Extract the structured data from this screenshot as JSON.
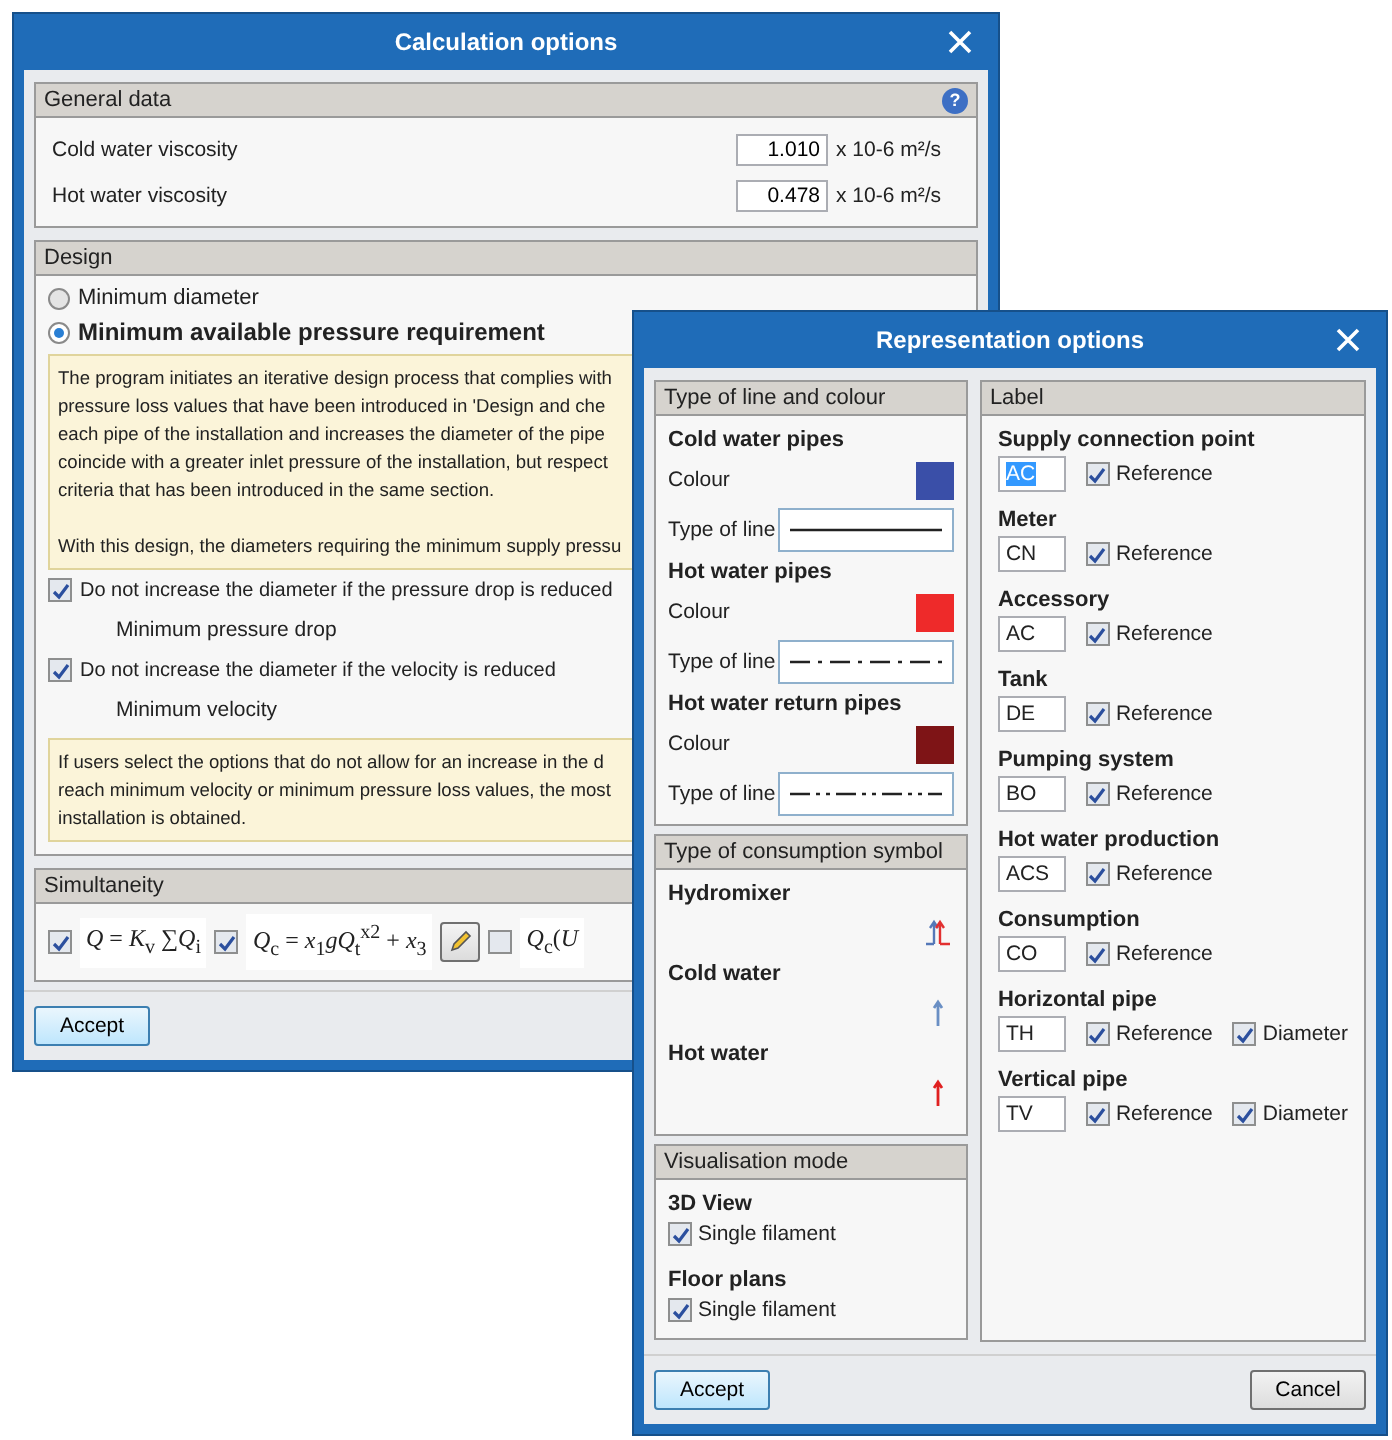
{
  "calculation_window": {
    "title": "Calculation options",
    "general_data": {
      "title": "General data",
      "help": "?",
      "rows": [
        {
          "label": "Cold water viscosity",
          "value": "1.010",
          "unit": "x 10-6 m²/s"
        },
        {
          "label": "Hot water viscosity",
          "value": "0.478",
          "unit": "x 10-6 m²/s"
        }
      ]
    },
    "design": {
      "title": "Design",
      "options": [
        {
          "label": "Minimum diameter",
          "selected": false
        },
        {
          "label": "Minimum available pressure requirement",
          "selected": true
        }
      ],
      "info": "The program initiates an iterative design process that complies with\npressure loss values that have been introduced in 'Design and che\neach pipe of the installation and increases the diameter of the pipe\ncoincide with a greater inlet pressure of the installation, but respect\ncriteria that has been introduced in the same section.\n\nWith this design, the diameters requiring the minimum supply pressu",
      "checks": [
        {
          "label": "Do not increase the diameter if the pressure drop is reduced",
          "checked": true,
          "sublabel": "Minimum pressure drop"
        },
        {
          "label": "Do not increase the diameter if the velocity is reduced",
          "checked": true,
          "sublabel": "Minimum velocity"
        }
      ],
      "note": "If users select the options that do not allow for an increase in the d\nreach minimum velocity or minimum pressure loss values, the most\ninstallation is obtained."
    },
    "simultaneity": {
      "title": "Simultaneity",
      "formulas": [
        {
          "formula": "*Q* = *K*$_{v}$ ∑*Q*$_{i}$",
          "checked": true,
          "editable": false
        },
        {
          "formula": "*Q*$_{c}$ = *x*$_{1}$*gQ*$_{t}$$^{x2}$ + *x*$_{3}$",
          "checked": true,
          "editable": true
        },
        {
          "formula": "*Q*$_{c}$(*U*",
          "checked": false,
          "editable": false
        }
      ]
    },
    "accept": "Accept"
  },
  "representation_window": {
    "title": "Representation options",
    "line_group": {
      "title": "Type of line and colour",
      "pipes": [
        {
          "name": "Cold water pipes",
          "colour_label": "Colour",
          "color": "#3a4fa8",
          "line_label": "Type of line",
          "kind": "solid"
        },
        {
          "name": "Hot water pipes",
          "colour_label": "Colour",
          "color": "#ee2a2a",
          "line_label": "Type of line",
          "kind": "dash-dot"
        },
        {
          "name": "Hot water return pipes",
          "colour_label": "Colour",
          "color": "#7e1416",
          "line_label": "Type of line",
          "kind": "dash-dot-dot"
        }
      ]
    },
    "symbol_group": {
      "title": "Type of consumption symbol",
      "symbols": [
        {
          "name": "Hydromixer",
          "kind": "mixed"
        },
        {
          "name": "Cold water",
          "kind": "cold"
        },
        {
          "name": "Hot water",
          "kind": "hot"
        }
      ]
    },
    "visualisation": {
      "title": "Visualisation mode",
      "modes": [
        {
          "name": "3D View",
          "option": "Single filament",
          "checked": true
        },
        {
          "name": "Floor plans",
          "option": "Single filament",
          "checked": true
        }
      ]
    },
    "label_group": {
      "title": "Label",
      "items": [
        {
          "name": "Supply connection point",
          "code": "AC",
          "text_selected": true,
          "reference": "Reference",
          "reference_checked": true
        },
        {
          "name": "Meter",
          "code": "CN",
          "text_selected": false,
          "reference": "Reference",
          "reference_checked": true
        },
        {
          "name": "Accessory",
          "code": "AC",
          "text_selected": false,
          "reference": "Reference",
          "reference_checked": true
        },
        {
          "name": "Tank",
          "code": "DE",
          "text_selected": false,
          "reference": "Reference",
          "reference_checked": true
        },
        {
          "name": "Pumping system",
          "code": "BO",
          "text_selected": false,
          "reference": "Reference",
          "reference_checked": true
        },
        {
          "name": "Hot water production",
          "code": "ACS",
          "text_selected": false,
          "reference": "Reference",
          "reference_checked": true
        },
        {
          "name": "Consumption",
          "code": "CO",
          "text_selected": false,
          "reference": "Reference",
          "reference_checked": true
        },
        {
          "name": "Horizontal pipe",
          "code": "TH",
          "text_selected": false,
          "reference": "Reference",
          "reference_checked": true,
          "diameter": "Diameter",
          "diameter_checked": true
        },
        {
          "name": "Vertical pipe",
          "code": "TV",
          "text_selected": false,
          "reference": "Reference",
          "reference_checked": true,
          "diameter": "Diameter",
          "diameter_checked": true
        }
      ]
    },
    "accept": "Accept",
    "cancel": "Cancel"
  }
}
